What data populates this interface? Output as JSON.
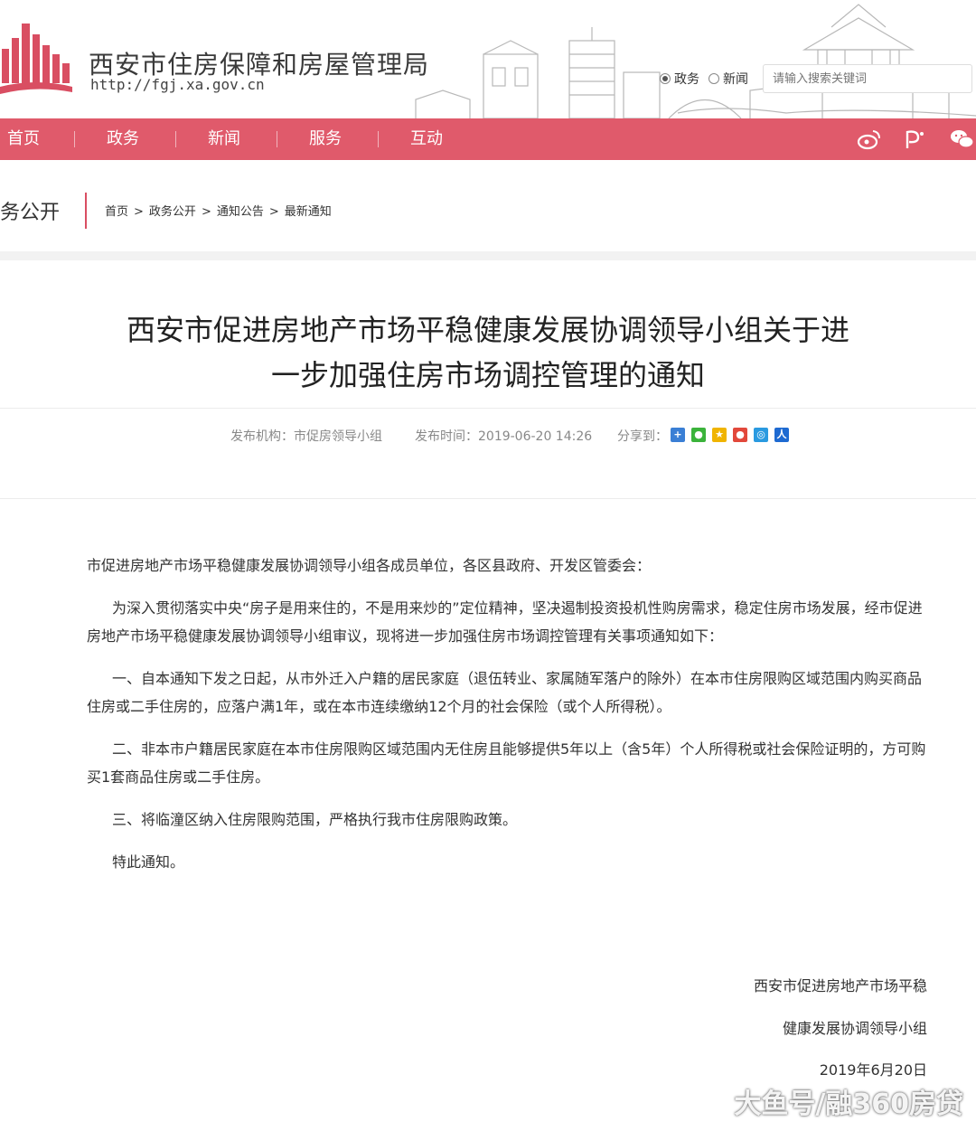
{
  "header": {
    "site_name": "西安市住房保障和房屋管理局",
    "site_url": "http://fgj.xa.gov.cn",
    "search": {
      "radio_options": [
        {
          "label": "政务",
          "selected": true
        },
        {
          "label": "新闻",
          "selected": false
        }
      ],
      "placeholder": "请输入搜索关键词"
    }
  },
  "nav": {
    "items": [
      "首页",
      "政务",
      "新闻",
      "服务",
      "互动"
    ],
    "icons": [
      "weibo-icon",
      "people-daily-icon",
      "wechat-icon"
    ],
    "color": "#e05a6b"
  },
  "section": {
    "title": "务公开",
    "breadcrumb": [
      "首页",
      "政务公开",
      "通知公告",
      "最新通知"
    ],
    "separator": ">"
  },
  "article": {
    "title_line1": "西安市促进房地产市场平稳健康发展协调领导小组关于进",
    "title_line2": "一步加强住房市场调控管理的通知",
    "meta": {
      "publisher": "发布机构：市促房领导小组",
      "time": "发布时间：2019-06-20 14:26",
      "share_label": "分享到："
    },
    "share_icons": [
      "more-share-icon",
      "wechat-share-icon",
      "qzone-share-icon",
      "weibo-share-icon",
      "tencent-weibo-share-icon",
      "renren-share-icon"
    ],
    "paragraphs": [
      "市促进房地产市场平稳健康发展协调领导小组各成员单位，各区县政府、开发区管委会：",
      "为深入贯彻落实中央“房子是用来住的，不是用来炒的”定位精神，坚决遏制投资投机性购房需求，稳定住房市场发展，经市促进房地产市场平稳健康发展协调领导小组审议，现将进一步加强住房市场调控管理有关事项通知如下：",
      "一、自本通知下发之日起，从市外迁入户籍的居民家庭（退伍转业、家属随军落户的除外）在本市住房限购区域范围内购买商品住房或二手住房的，应落户满1年，或在本市连续缴纳12个月的社会保险（或个人所得税）。",
      "二、非本市户籍居民家庭在本市住房限购区域范围内无住房且能够提供5年以上（含5年）个人所得税或社会保险证明的，方可购买1套商品住房或二手住房。",
      "三、将临潼区纳入住房限购范围，严格执行我市住房限购政策。",
      "特此通知。"
    ],
    "signature": [
      "西安市促进房地产市场平稳",
      "健康发展协调领导小组",
      "2019年6月20日"
    ]
  },
  "watermark": "大鱼号/融360房贷"
}
